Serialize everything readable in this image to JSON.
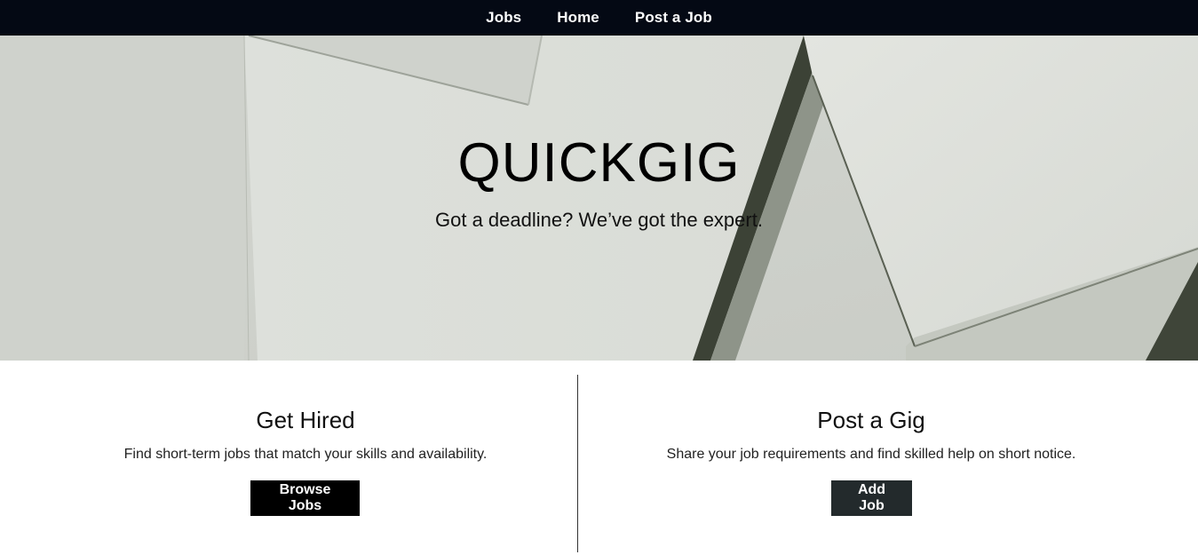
{
  "nav": {
    "items": [
      {
        "label": "Jobs"
      },
      {
        "label": "Home"
      },
      {
        "label": "Post a Job"
      }
    ]
  },
  "hero": {
    "title": "QUICKGIG",
    "subtitle": "Got a deadline? We’ve got the expert.",
    "background_color": "#dfe1dc"
  },
  "panels": {
    "hire": {
      "title": "Get Hired",
      "description": "Find short-term jobs that match your skills and availability.",
      "button_label": "Browse Jobs"
    },
    "post": {
      "title": "Post a Gig",
      "description": "Share your job requirements and find skilled help on short notice.",
      "button_label": "Add Job"
    }
  },
  "colors": {
    "navbar": "#040914",
    "browse_button": "#000000",
    "add_button": "#232a2c"
  }
}
